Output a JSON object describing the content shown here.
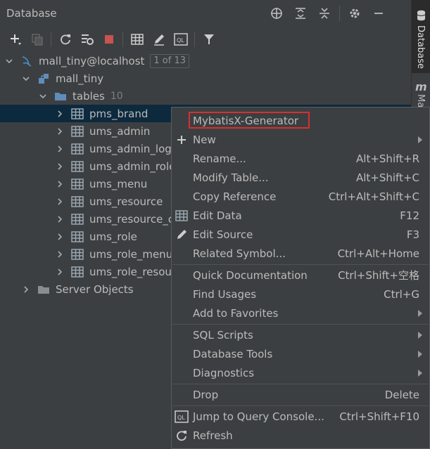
{
  "panel": {
    "title": "Database"
  },
  "right_strip": {
    "tab_label": "Database",
    "second_label": "Ma"
  },
  "tree": {
    "connection": {
      "label": "mall_tiny@localhost",
      "badge": "1 of 13"
    },
    "schema": {
      "label": "mall_tiny"
    },
    "tables_folder": {
      "label": "tables",
      "count": "10"
    },
    "tables": [
      "pms_brand",
      "ums_admin",
      "ums_admin_logi",
      "ums_admin_role",
      "ums_menu",
      "ums_resource",
      "ums_resource_c",
      "ums_role",
      "ums_role_menu_",
      "ums_role_resour"
    ],
    "server_objects": {
      "label": "Server Objects"
    }
  },
  "menu": {
    "generator": "MybatisX-Generator",
    "new": "New",
    "rename": "Rename...",
    "rename_sc": "Alt+Shift+R",
    "modify": "Modify Table...",
    "modify_sc": "Alt+Shift+C",
    "copy_ref": "Copy Reference",
    "copy_ref_sc": "Ctrl+Alt+Shift+C",
    "edit_data": "Edit Data",
    "edit_data_sc": "F12",
    "edit_source": "Edit Source",
    "edit_source_sc": "F3",
    "related": "Related Symbol...",
    "related_sc": "Ctrl+Alt+Home",
    "quick_doc": "Quick Documentation",
    "quick_doc_sc": "Ctrl+Shift+空格",
    "find_usages": "Find Usages",
    "find_usages_sc": "Ctrl+G",
    "favorites": "Add to Favorites",
    "sql_scripts": "SQL Scripts",
    "db_tools": "Database Tools",
    "diagnostics": "Diagnostics",
    "drop": "Drop",
    "drop_sc": "Delete",
    "jump": "Jump to Query Console...",
    "jump_sc": "Ctrl+Shift+F10",
    "refresh": "Refresh"
  },
  "colors": {
    "selection": "#0d293e",
    "highlight_border": "#d63031",
    "delete_red": "#c75450",
    "table_icon": "#9aa7b0",
    "folder_blue": "#5f8dbb"
  }
}
